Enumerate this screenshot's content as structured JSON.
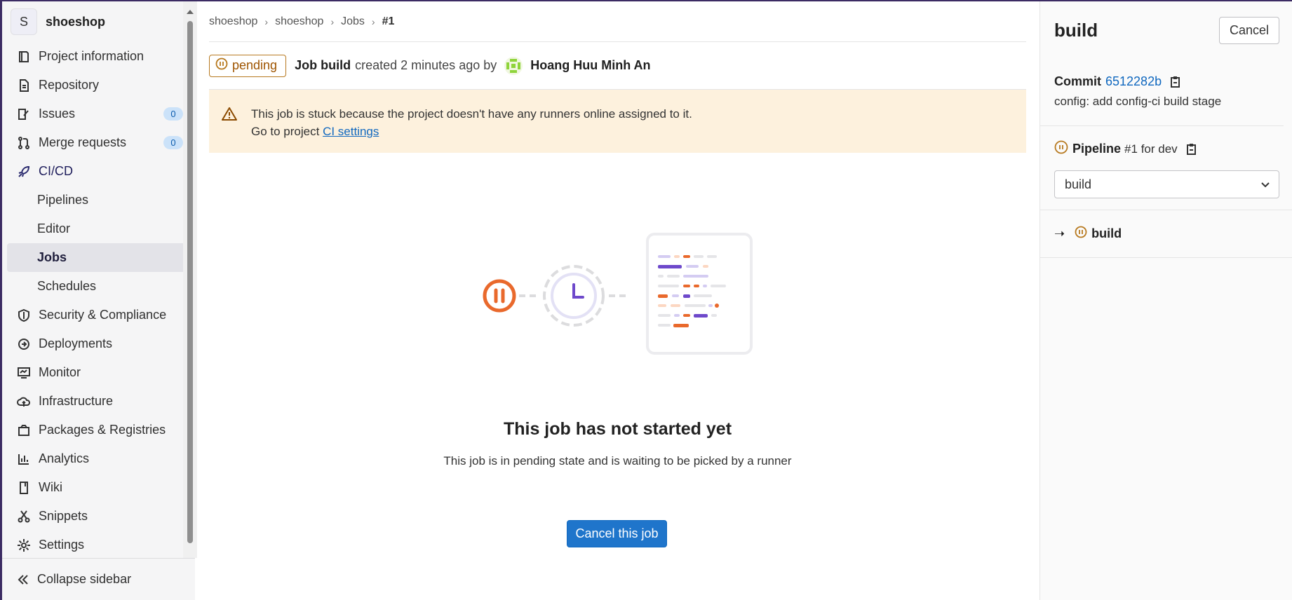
{
  "sidebar": {
    "avatar_letter": "S",
    "project_name": "shoeshop",
    "items": [
      {
        "label": "Project information",
        "icon": "project-info-icon"
      },
      {
        "label": "Repository",
        "icon": "repository-icon"
      },
      {
        "label": "Issues",
        "icon": "issues-icon",
        "badge": "0"
      },
      {
        "label": "Merge requests",
        "icon": "merge-request-icon",
        "badge": "0"
      },
      {
        "label": "CI/CD",
        "icon": "rocket-icon"
      },
      {
        "label": "Pipelines"
      },
      {
        "label": "Editor"
      },
      {
        "label": "Jobs",
        "active": true
      },
      {
        "label": "Schedules"
      },
      {
        "label": "Security & Compliance",
        "icon": "shield-icon"
      },
      {
        "label": "Deployments",
        "icon": "deployments-icon"
      },
      {
        "label": "Monitor",
        "icon": "monitor-icon"
      },
      {
        "label": "Infrastructure",
        "icon": "cloud-icon"
      },
      {
        "label": "Packages & Registries",
        "icon": "package-icon"
      },
      {
        "label": "Analytics",
        "icon": "chart-icon"
      },
      {
        "label": "Wiki",
        "icon": "book-icon"
      },
      {
        "label": "Snippets",
        "icon": "scissors-icon"
      },
      {
        "label": "Settings",
        "icon": "gear-icon"
      }
    ],
    "collapse_label": "Collapse sidebar"
  },
  "breadcrumb": [
    "shoeshop",
    "shoeshop",
    "Jobs",
    "#1"
  ],
  "job": {
    "status": "pending",
    "title_prefix": "Job",
    "name": "build",
    "created_text": "created 2 minutes ago by",
    "author": "Hoang Huu Minh An"
  },
  "alert": {
    "line1": "This job is stuck because the project doesn't have any runners online assigned to it.",
    "line2_prefix": "Go to project",
    "link": "CI settings"
  },
  "empty_state": {
    "title": "This job has not started yet",
    "description": "This job is in pending state and is waiting to be picked by a runner",
    "button": "Cancel this job"
  },
  "panel": {
    "title": "build",
    "cancel": "Cancel",
    "commit_label": "Commit",
    "commit_sha": "6512282b",
    "commit_message": "config: add config-ci build stage",
    "pipeline_label": "Pipeline",
    "pipeline_id": "#1",
    "pipeline_ref": "for dev",
    "stage_select": "build",
    "job_name": "build"
  },
  "colors": {
    "accent": "#1f75cb",
    "pending": "#b7791f",
    "alert_bg": "#fdf1dd",
    "sidebar_bg": "#f5f5f6"
  }
}
